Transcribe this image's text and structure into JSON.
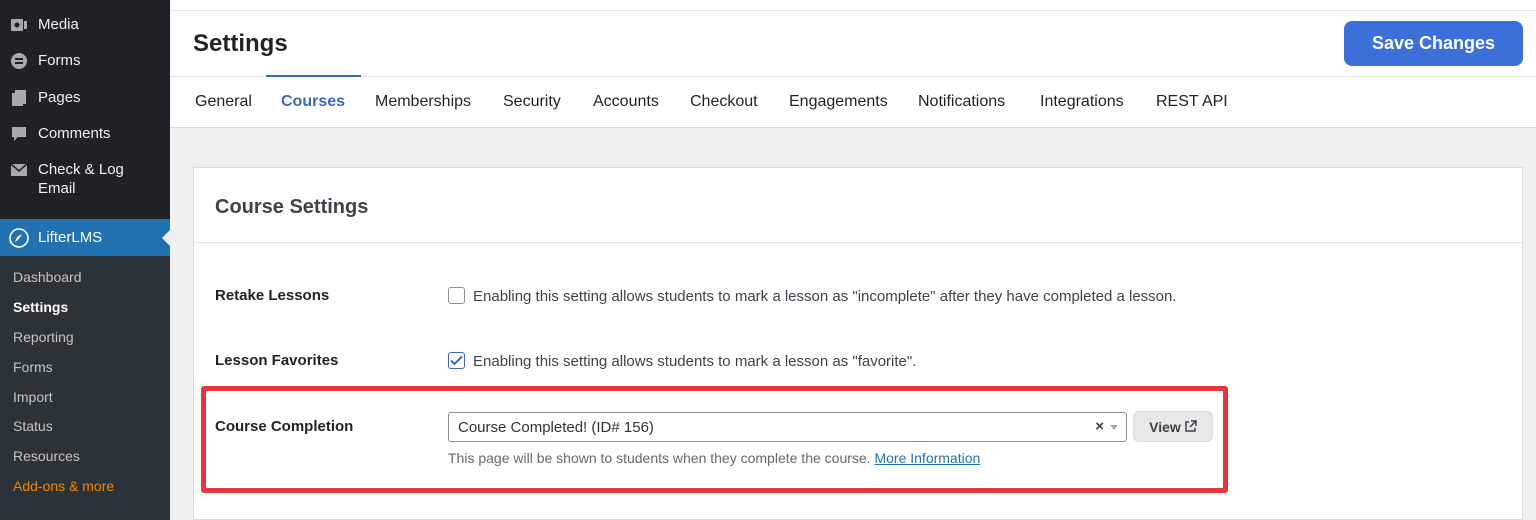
{
  "sidebar": {
    "items": [
      {
        "label": "Media",
        "icon": "media-icon"
      },
      {
        "label": "Forms",
        "icon": "forms-icon"
      },
      {
        "label": "Pages",
        "icon": "pages-icon"
      },
      {
        "label": "Comments",
        "icon": "comments-icon"
      },
      {
        "label": "Check & Log",
        "label2": "Email",
        "icon": "mail-icon"
      },
      {
        "label": "LifterLMS",
        "icon": "rocket-icon"
      }
    ],
    "submenu": [
      "Dashboard",
      "Settings",
      "Reporting",
      "Forms",
      "Import",
      "Status",
      "Resources",
      "Add-ons & more"
    ],
    "current": "Settings"
  },
  "header": {
    "title": "Settings",
    "save_label": "Save Changes",
    "tabs": [
      "General",
      "Courses",
      "Memberships",
      "Security",
      "Accounts",
      "Checkout",
      "Engagements",
      "Notifications",
      "Integrations",
      "REST API"
    ],
    "active_tab": "Courses"
  },
  "panel": {
    "title": "Course Settings",
    "retake": {
      "label": "Retake Lessons",
      "checked": false,
      "text": "Enabling this setting allows students to mark a lesson as \"incomplete\" after they have completed a lesson."
    },
    "favorites": {
      "label": "Lesson Favorites",
      "checked": true,
      "text": "Enabling this setting allows students to mark a lesson as \"favorite\"."
    },
    "completion": {
      "label": "Course Completion",
      "selected": "Course Completed! (ID# 156)",
      "clear": "×",
      "view_label": "View",
      "help": "This page will be shown to students when they complete the course.",
      "link": "More Information"
    }
  },
  "colors": {
    "accent": "#3a66c6",
    "save_button": "#3d6fd8",
    "highlight": "#e8343f",
    "sidebar_bg": "#1d2327",
    "sidebar_active": "#2271b1",
    "addons": "#f18500"
  }
}
